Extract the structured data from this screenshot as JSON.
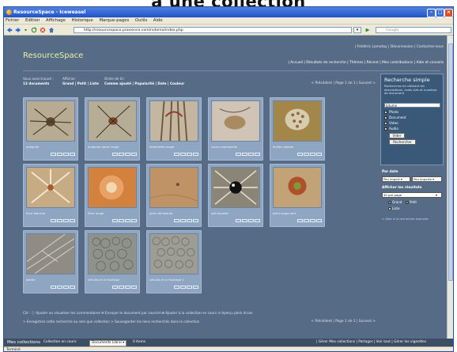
{
  "banner": {
    "text": "à une collection"
  },
  "window": {
    "title": "ResourceSpace - Iceweasel",
    "menus": [
      "Fichier",
      "Edition",
      "Affichage",
      "Historique",
      "Marque-pages",
      "Outils",
      "Aide"
    ],
    "url": "http://resourcespace.proxience.com/rsdemo/index.php",
    "search_placeholder": "Google",
    "status": "Terminé"
  },
  "site": {
    "logo": "ResourceSpace",
    "user_menu": "| Frédéric Lamotay  | Déconnexion  | Contactez-nous",
    "main_nav": "| Accueil  | Résultats de recherche  | Thèmes  | Récent  | Mes contributions  | Aide et conseils"
  },
  "controls": {
    "results_label": "Vous avez trouvé :",
    "results_value": "13 documents",
    "display_label": "Afficher",
    "display_options": "Grand | Petit | Liste",
    "order_label": "Ordre de tri:",
    "order_options": "Comme ajouté | Popularité | Date | Couleur",
    "pager": "< Précédent  | Page 1 de 1 |  Suivant >"
  },
  "resources": [
    {
      "caption": "araignée",
      "color": "#b7ab93"
    },
    {
      "caption": "araignée dorsé rouge",
      "color": "#b6ad97"
    },
    {
      "caption": "deformées rouge",
      "color": "#c4b6a0"
    },
    {
      "caption": "cocon marronaille",
      "color": "#cfc4b5"
    },
    {
      "caption": "feuille malade",
      "color": "#a3874a"
    },
    {
      "caption": "fleur blanche",
      "color": "#c7ab82"
    },
    {
      "caption": "fleur rouge",
      "color": "#d2823d"
    },
    {
      "caption": "grain de beaute",
      "color": "#bf9366"
    },
    {
      "caption": "oeil buvette",
      "color": "#8a8576"
    },
    {
      "caption": "pistil rouge-vert",
      "color": "#c2a378"
    },
    {
      "caption": "plante",
      "color": "#8f8c85"
    },
    {
      "caption": "cellules d'un feuillage",
      "color": "#8f928b"
    },
    {
      "caption": "cellules d'un feuillage 2",
      "color": "#9d9d96"
    }
  ],
  "legend": {
    "text": "Clé :  ⓘ Ajouter ou visualiser les commentaires   ✉ Envoyer le document par courriel   ⊞ Ajouter à la collection en cours   ⊡ Aperçu plein écran",
    "links": "> Enregistrez cette recherche au sein que collection   > Sauvegarder les liens recherchés dans la collection"
  },
  "search": {
    "title": "Recherche simple",
    "description": "Recherchez en utilisant les descriptions, mots clés et numéros de document",
    "query": "bitume",
    "types": [
      "Photo",
      "Document",
      "Video",
      "Audio"
    ],
    "clear_button": "Vider",
    "search_button": "Rechercher",
    "date_label": "Par date",
    "year_select": "Peu import ▾",
    "month_select": "Peu importe ▾",
    "results_label": "Afficher les résultats",
    "per_page": "40 par page",
    "view_large": "Grand",
    "view_small": "Petit",
    "view_list": "Liste",
    "advanced_link": "> Aller à la recherche avancée"
  },
  "collections": {
    "title": "Mes collections",
    "current_label": "Collection en cours:",
    "current": "Documents Librai ▾",
    "count": "0 items",
    "actions": "| Gérer Mes collections  | Partager  | Voir tout  | Gérer les vignettes"
  }
}
